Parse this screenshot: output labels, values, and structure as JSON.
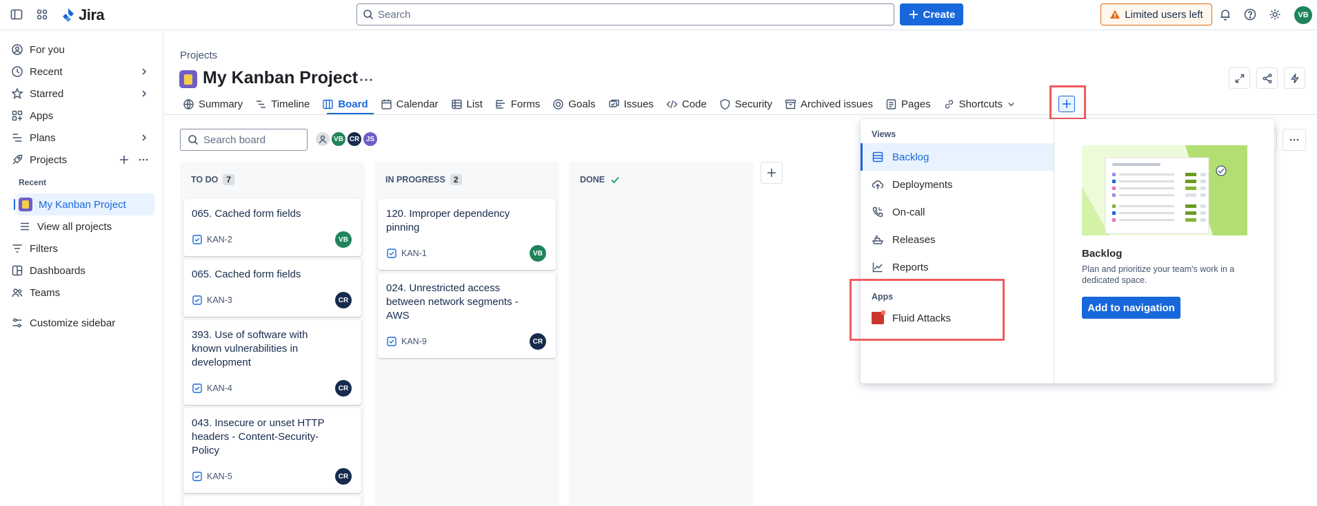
{
  "topbar": {
    "app_name": "Jira",
    "search_placeholder": "Search",
    "create_label": "Create",
    "limited_label": "Limited users left",
    "user_initials": "VB",
    "icons": [
      "sidebar-toggle-icon",
      "app-switcher-icon",
      "jira-logo-icon",
      "search-icon",
      "plus-icon",
      "warning-icon",
      "bell-icon",
      "help-icon",
      "gear-icon"
    ]
  },
  "sidebar": {
    "items": [
      {
        "label": "For you",
        "icon": "user-circle-icon"
      },
      {
        "label": "Recent",
        "icon": "clock-icon"
      },
      {
        "label": "Starred",
        "icon": "star-icon"
      },
      {
        "label": "Apps",
        "icon": "apps-icon"
      },
      {
        "label": "Plans",
        "icon": "plans-icon"
      },
      {
        "label": "Projects",
        "icon": "rocket-icon"
      }
    ],
    "recent_heading": "Recent",
    "recent_project": "My Kanban Project",
    "view_all": "View all projects",
    "bottom_items": [
      {
        "label": "Filters",
        "icon": "filter-icon"
      },
      {
        "label": "Dashboards",
        "icon": "dashboard-icon"
      },
      {
        "label": "Teams",
        "icon": "people-icon"
      }
    ],
    "customize": "Customize sidebar"
  },
  "header": {
    "breadcrumb": "Projects",
    "title": "My Kanban Project"
  },
  "tabs": [
    {
      "label": "Summary",
      "icon": "globe-icon"
    },
    {
      "label": "Timeline",
      "icon": "timeline-icon"
    },
    {
      "label": "Board",
      "icon": "board-icon",
      "active": true
    },
    {
      "label": "Calendar",
      "icon": "calendar-icon"
    },
    {
      "label": "List",
      "icon": "list-icon"
    },
    {
      "label": "Forms",
      "icon": "forms-icon"
    },
    {
      "label": "Goals",
      "icon": "goal-icon"
    },
    {
      "label": "Issues",
      "icon": "issues-icon"
    },
    {
      "label": "Code",
      "icon": "code-icon"
    },
    {
      "label": "Security",
      "icon": "shield-icon"
    },
    {
      "label": "Archived issues",
      "icon": "archive-icon"
    },
    {
      "label": "Pages",
      "icon": "page-icon"
    },
    {
      "label": "Shortcuts",
      "icon": "link-icon"
    }
  ],
  "board": {
    "search_placeholder": "Search board",
    "avatars": [
      {
        "initials": "VB",
        "color": "#1f845a"
      },
      {
        "initials": "CR",
        "color": "#172b4d"
      },
      {
        "initials": "JS",
        "color": "#6e5dc6"
      }
    ],
    "columns": [
      {
        "name": "TO DO",
        "count": "7",
        "cards": [
          {
            "title": "065. Cached form fields",
            "key": "KAN-2",
            "assignee": "VB",
            "color": "#1f845a"
          },
          {
            "title": "065. Cached form fields",
            "key": "KAN-3",
            "assignee": "CR",
            "color": "#172b4d"
          },
          {
            "title": "393. Use of software with known vulnerabilities in development",
            "key": "KAN-4",
            "assignee": "CR",
            "color": "#172b4d"
          },
          {
            "title": "043. Insecure or unset HTTP headers - Content-Security-Policy",
            "key": "KAN-5",
            "assignee": "CR",
            "color": "#172b4d"
          }
        ]
      },
      {
        "name": "IN PROGRESS",
        "count": "2",
        "cards": [
          {
            "title": "120. Improper dependency pinning",
            "key": "KAN-1",
            "assignee": "VB",
            "color": "#1f845a"
          },
          {
            "title": "024. Unrestricted access between network segments - AWS",
            "key": "KAN-9",
            "assignee": "CR",
            "color": "#172b4d"
          }
        ]
      },
      {
        "name": "DONE",
        "count": "",
        "cards": []
      }
    ]
  },
  "dropdown": {
    "views_heading": "Views",
    "views": [
      {
        "label": "Backlog",
        "icon": "backlog-icon",
        "selected": true
      },
      {
        "label": "Deployments",
        "icon": "cloud-upload-icon"
      },
      {
        "label": "On-call",
        "icon": "phone-icon"
      },
      {
        "label": "Releases",
        "icon": "ship-icon"
      },
      {
        "label": "Reports",
        "icon": "chart-line-icon"
      }
    ],
    "apps_heading": "Apps",
    "apps": [
      {
        "label": "Fluid Attacks",
        "icon": "fluid-attacks-logo"
      }
    ],
    "preview_title": "Backlog",
    "preview_desc": "Plan and prioritize your team's work in a dedicated space.",
    "preview_button": "Add to navigation"
  },
  "colors": {
    "accent": "#1868db",
    "highlight": "#f15b5b",
    "warning": "#e56910"
  }
}
